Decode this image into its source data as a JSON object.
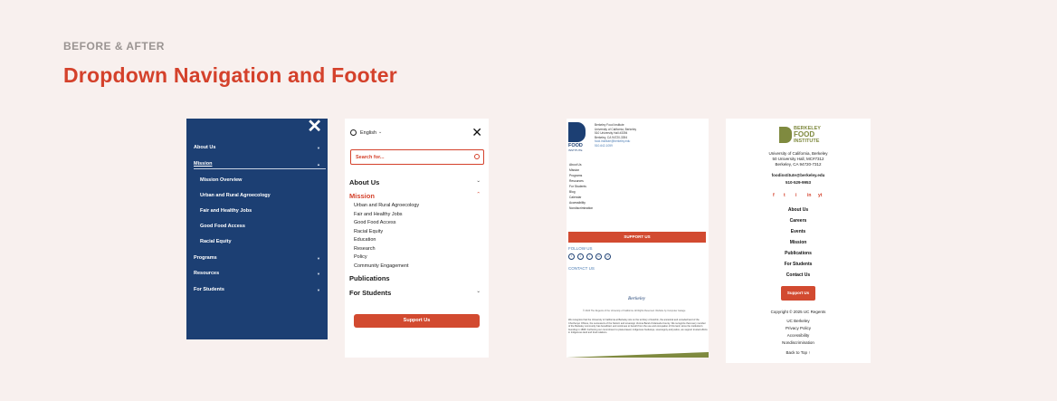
{
  "header": {
    "eyebrow": "BEFORE & AFTER",
    "title": "Dropdown Navigation and Footer"
  },
  "old_nav": {
    "close_icon": "close-icon",
    "items": [
      {
        "label": "About Us"
      },
      {
        "label": "Mission"
      },
      {
        "label": "Programs"
      },
      {
        "label": "Resources"
      },
      {
        "label": "For Students"
      }
    ],
    "mission_sub": [
      "Mission Overview",
      "Urban and Rural Agroecology",
      "Fair and Healthy Jobs",
      "Good Food Access",
      "Racial Equity"
    ]
  },
  "new_nav": {
    "language": "English",
    "search_placeholder": "Search for...",
    "sections": [
      "About Us",
      "Mission",
      "Publications",
      "For Students"
    ],
    "mission_sub": [
      "Urban and Rural Agroecology",
      "Fair and Healthy Jobs",
      "Good Food Access",
      "Racial Equity",
      "Education",
      "Research",
      "Policy",
      "Community Engagement"
    ],
    "cta": "Support Us",
    "accent": "#d4412b"
  },
  "old_footer": {
    "logo_word": "FOOD",
    "logo_sub": "INSTITUTE",
    "address": [
      "Berkeley Food Institute",
      "University of California, Berkeley",
      "510 University Hall #3394",
      "Berkeley, CA 94720-3394"
    ],
    "email": "food.institute@berkeley.edu",
    "phone": "510-642-1059",
    "nav": [
      "About Us",
      "Mission",
      "Programs",
      "Resources",
      "For Students",
      "Blog",
      "Calendar",
      "Accessibility",
      "Nondiscrimination"
    ],
    "cta": "SUPPORT US",
    "follow": "FOLLOW US",
    "social": [
      "f",
      "t",
      "i",
      "in",
      "yt"
    ],
    "contact": "CONTACT US",
    "berkeley": "Berkeley",
    "copyright": "© 2024 The Regents of the University of California. All Rights Reserved. Website by Computer Garage",
    "land": "We recognize that the University of California at Berkeley sits on the territory of Huichin, the ancestral and unceded land of the Chochenyo Ohlone, the successors of the historic and sovereign Verona Band of Alameda County. We recognize that every member of the Berkeley community has benefitted, and continues to benefit from the use and occupation of this land, since the institution's founding in 1868. Furthering our commitment to place-based, indigenous foodways, sovereignty and justice, we support trusted efforts in Indigenous land and food relations."
  },
  "new_footer": {
    "logo_t1": "BERKELEY",
    "logo_t2": "FOOD",
    "logo_t3": "INSTITUTE",
    "address": [
      "University of California, Berkeley",
      "50 University Hall, MC#7312",
      "Berkeley, CA 94720-7312"
    ],
    "email": "foodinstitute@berkeley.edu",
    "phone": "510-529-9953",
    "social": [
      "f",
      "t",
      "i",
      "in",
      "yt"
    ],
    "nav": [
      "About Us",
      "Careers",
      "Events",
      "Mission",
      "Publications",
      "For Students",
      "Contact Us"
    ],
    "cta": "Support Us",
    "copyright": "Copyright © 2025 UC Regents",
    "links": [
      "UC Berkeley",
      "Privacy Policy",
      "Accessibility",
      "Nondiscrimination"
    ],
    "back_to_top": "Back to Top ↑"
  }
}
